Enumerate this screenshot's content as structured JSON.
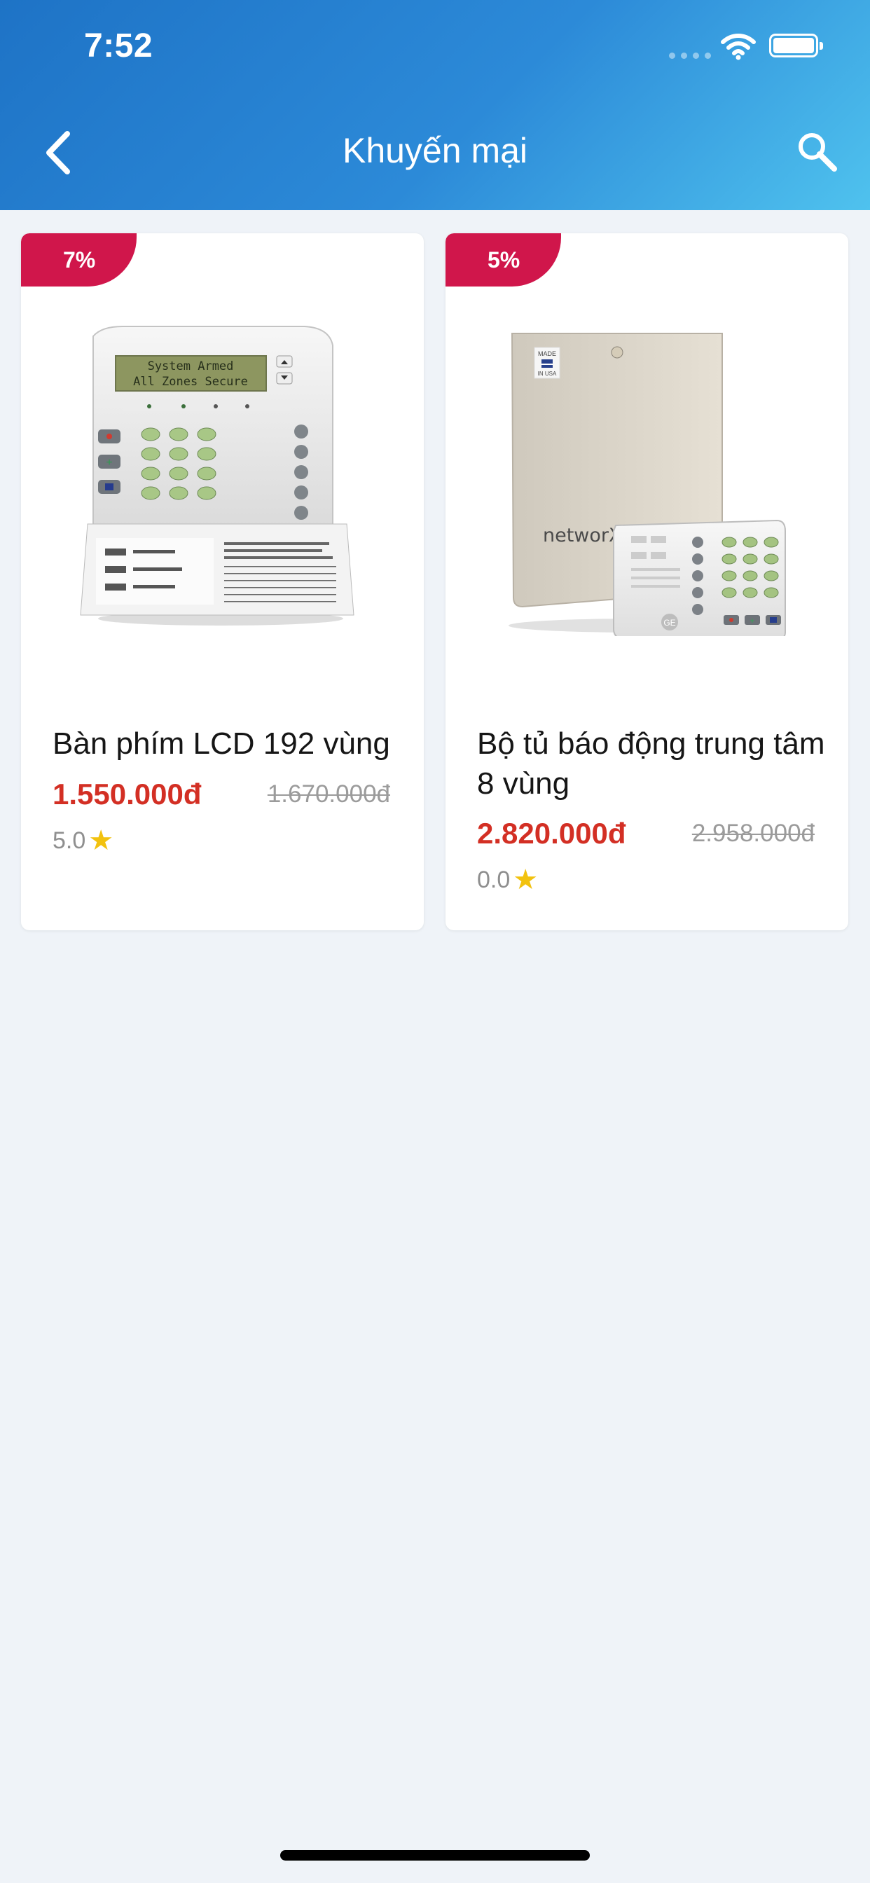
{
  "status_bar": {
    "time": "7:52",
    "signal_icon": "cellular-signal-icon",
    "wifi_icon": "wifi-icon",
    "battery_icon": "battery-icon"
  },
  "header": {
    "title": "Khuyến mại",
    "back_icon": "back-arrow-icon",
    "search_icon": "search-icon"
  },
  "products": [
    {
      "discount": "7%",
      "name": "Bàn phím LCD 192 vùng",
      "price": "1.550.000đ",
      "old_price": "1.670.000đ",
      "rating": "5.0",
      "star_icon": "star-icon"
    },
    {
      "discount": "5%",
      "name": "Bộ tủ báo động trung tâm 8 vùng",
      "price": "2.820.000đ",
      "old_price": "2.958.000đ",
      "rating": "0.0",
      "star_icon": "star-icon"
    }
  ],
  "colors": {
    "header_start": "#1e73c6",
    "header_end": "#4fc2ee",
    "discount_badge": "#d0164b",
    "price": "#d32f24",
    "star": "#f2c20f",
    "background": "#eff3f8"
  },
  "lcd_text": {
    "line1": "System Armed",
    "line2": "All Zones Secure"
  },
  "networx_label": "networX"
}
